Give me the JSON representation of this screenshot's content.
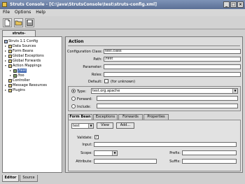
{
  "window": {
    "title": "Struts Console - [C:\\java\\StrutsConsole\\test\\struts-config.xml]",
    "controls": [
      "_",
      "□",
      "×"
    ]
  },
  "menu": [
    "File",
    "Options",
    "Help"
  ],
  "toolbar": {
    "buttons": [
      "new-file-icon",
      "open-folder-icon",
      "save-icon"
    ]
  },
  "file_tab": "struts-config.xml",
  "tree": {
    "root": "Struts 1.1 Config",
    "items": [
      "Data Sources",
      "Form Beans",
      "Global Exceptions",
      "Global Forwards",
      "Action Mappings"
    ],
    "action_children": [
      "/test",
      "/foo"
    ],
    "items_after": [
      "Controller",
      "Message Resources",
      "Plugins"
    ]
  },
  "action": {
    "heading": "Action",
    "labels": {
      "configuration_class": "Configuration Class:",
      "path": "Path:",
      "parameter": "Parameter:",
      "roles": "Roles:",
      "default": "Default:"
    },
    "values": {
      "configuration_class": "test.class",
      "path": "/test",
      "parameter": "",
      "roles": "",
      "default": "(for unknown)"
    },
    "radios": [
      {
        "label": "Type:",
        "value": "test.org.apache",
        "selected": true
      },
      {
        "label": "Forward:",
        "value": "",
        "selected": false
      },
      {
        "label": "Include:",
        "value": "",
        "selected": false
      }
    ],
    "subtabs": [
      "Form Bean",
      "Exceptions",
      "Forwards",
      "Properties"
    ],
    "form_bean": {
      "selected": "test",
      "view_button": "View",
      "add_button": "Add...",
      "validate_label": "Validate:",
      "validate_checked": true,
      "input_label": "Input:",
      "scope_label": "Scope:",
      "prefix_label": "Prefix:",
      "attribute_label": "Attribute:",
      "suffix_label": "Suffix:"
    }
  },
  "bottom_tabs": [
    "Editor",
    "Source"
  ]
}
